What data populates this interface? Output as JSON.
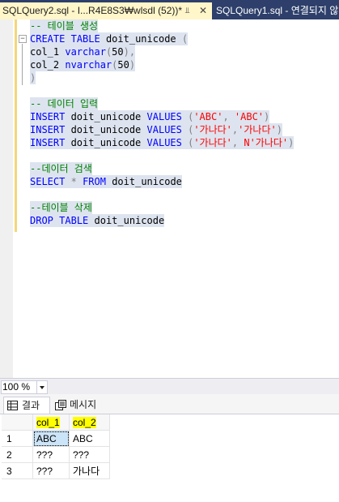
{
  "tabs": [
    {
      "label": "SQLQuery2.sql - I...R4E8S3₩wlsdl (52))*",
      "active": true
    },
    {
      "label": "SQLQuery1.sql - 연결되지 않",
      "active": false
    }
  ],
  "editor": {
    "lines": [
      {
        "tokens": [
          {
            "t": "-- 테이블 생성",
            "c": "cmt"
          }
        ]
      },
      {
        "tokens": [
          {
            "t": "CREATE",
            "c": "kw"
          },
          {
            "t": " ",
            "c": "id"
          },
          {
            "t": "TABLE",
            "c": "kw"
          },
          {
            "t": " doit_unicode ",
            "c": "id"
          },
          {
            "t": "(",
            "c": "gray"
          }
        ]
      },
      {
        "tokens": [
          {
            "t": "col_1 ",
            "c": "id"
          },
          {
            "t": "varchar",
            "c": "kw"
          },
          {
            "t": "(",
            "c": "gray"
          },
          {
            "t": "50",
            "c": "id"
          },
          {
            "t": "),",
            "c": "gray"
          }
        ]
      },
      {
        "tokens": [
          {
            "t": "col_2 ",
            "c": "id"
          },
          {
            "t": "nvarchar",
            "c": "kw"
          },
          {
            "t": "(",
            "c": "gray"
          },
          {
            "t": "50",
            "c": "id"
          },
          {
            "t": ")",
            "c": "gray"
          }
        ]
      },
      {
        "tokens": [
          {
            "t": ")",
            "c": "gray"
          }
        ]
      },
      {
        "tokens": []
      },
      {
        "tokens": [
          {
            "t": "-- 데이터 입력",
            "c": "cmt"
          }
        ]
      },
      {
        "tokens": [
          {
            "t": "INSERT",
            "c": "kw"
          },
          {
            "t": " doit_unicode ",
            "c": "id"
          },
          {
            "t": "VALUES",
            "c": "kw"
          },
          {
            "t": " (",
            "c": "gray"
          },
          {
            "t": "'ABC'",
            "c": "str"
          },
          {
            "t": ", ",
            "c": "gray"
          },
          {
            "t": "'ABC'",
            "c": "str"
          },
          {
            "t": ")",
            "c": "gray"
          }
        ]
      },
      {
        "tokens": [
          {
            "t": "INSERT",
            "c": "kw"
          },
          {
            "t": " doit_unicode ",
            "c": "id"
          },
          {
            "t": "VALUES",
            "c": "kw"
          },
          {
            "t": " (",
            "c": "gray"
          },
          {
            "t": "'가나다'",
            "c": "str"
          },
          {
            "t": ",",
            "c": "gray"
          },
          {
            "t": "'가나다'",
            "c": "str"
          },
          {
            "t": ")",
            "c": "gray"
          }
        ]
      },
      {
        "tokens": [
          {
            "t": "INSERT",
            "c": "kw"
          },
          {
            "t": " doit_unicode ",
            "c": "id"
          },
          {
            "t": "VALUES",
            "c": "kw"
          },
          {
            "t": " (",
            "c": "gray"
          },
          {
            "t": "'가나다'",
            "c": "str"
          },
          {
            "t": ", ",
            "c": "gray"
          },
          {
            "t": "N'가나다'",
            "c": "str"
          },
          {
            "t": ")",
            "c": "gray"
          }
        ]
      },
      {
        "tokens": []
      },
      {
        "tokens": [
          {
            "t": "--데이터 검색",
            "c": "cmt"
          }
        ]
      },
      {
        "tokens": [
          {
            "t": "SELECT",
            "c": "kw"
          },
          {
            "t": " ",
            "c": "id"
          },
          {
            "t": "*",
            "c": "gray"
          },
          {
            "t": " ",
            "c": "id"
          },
          {
            "t": "FROM",
            "c": "kw"
          },
          {
            "t": " doit_unicode",
            "c": "id"
          }
        ]
      },
      {
        "tokens": []
      },
      {
        "tokens": [
          {
            "t": "--테이블 삭제",
            "c": "cmt"
          }
        ]
      },
      {
        "tokens": [
          {
            "t": "DROP",
            "c": "kw"
          },
          {
            "t": " ",
            "c": "id"
          },
          {
            "t": "TABLE",
            "c": "kw"
          },
          {
            "t": " doit_unicode",
            "c": "id"
          }
        ]
      }
    ]
  },
  "zoom": {
    "value": "100 %"
  },
  "results_tabs": [
    {
      "label": "결과",
      "icon": "grid-icon"
    },
    {
      "label": "메시지",
      "icon": "messages-icon"
    }
  ],
  "grid": {
    "columns": [
      "col_1",
      "col_2"
    ],
    "rows": [
      {
        "num": "1",
        "cells": [
          "ABC",
          "ABC"
        ]
      },
      {
        "num": "2",
        "cells": [
          "???",
          "???"
        ]
      },
      {
        "num": "3",
        "cells": [
          "???",
          "가나다"
        ]
      }
    ]
  }
}
